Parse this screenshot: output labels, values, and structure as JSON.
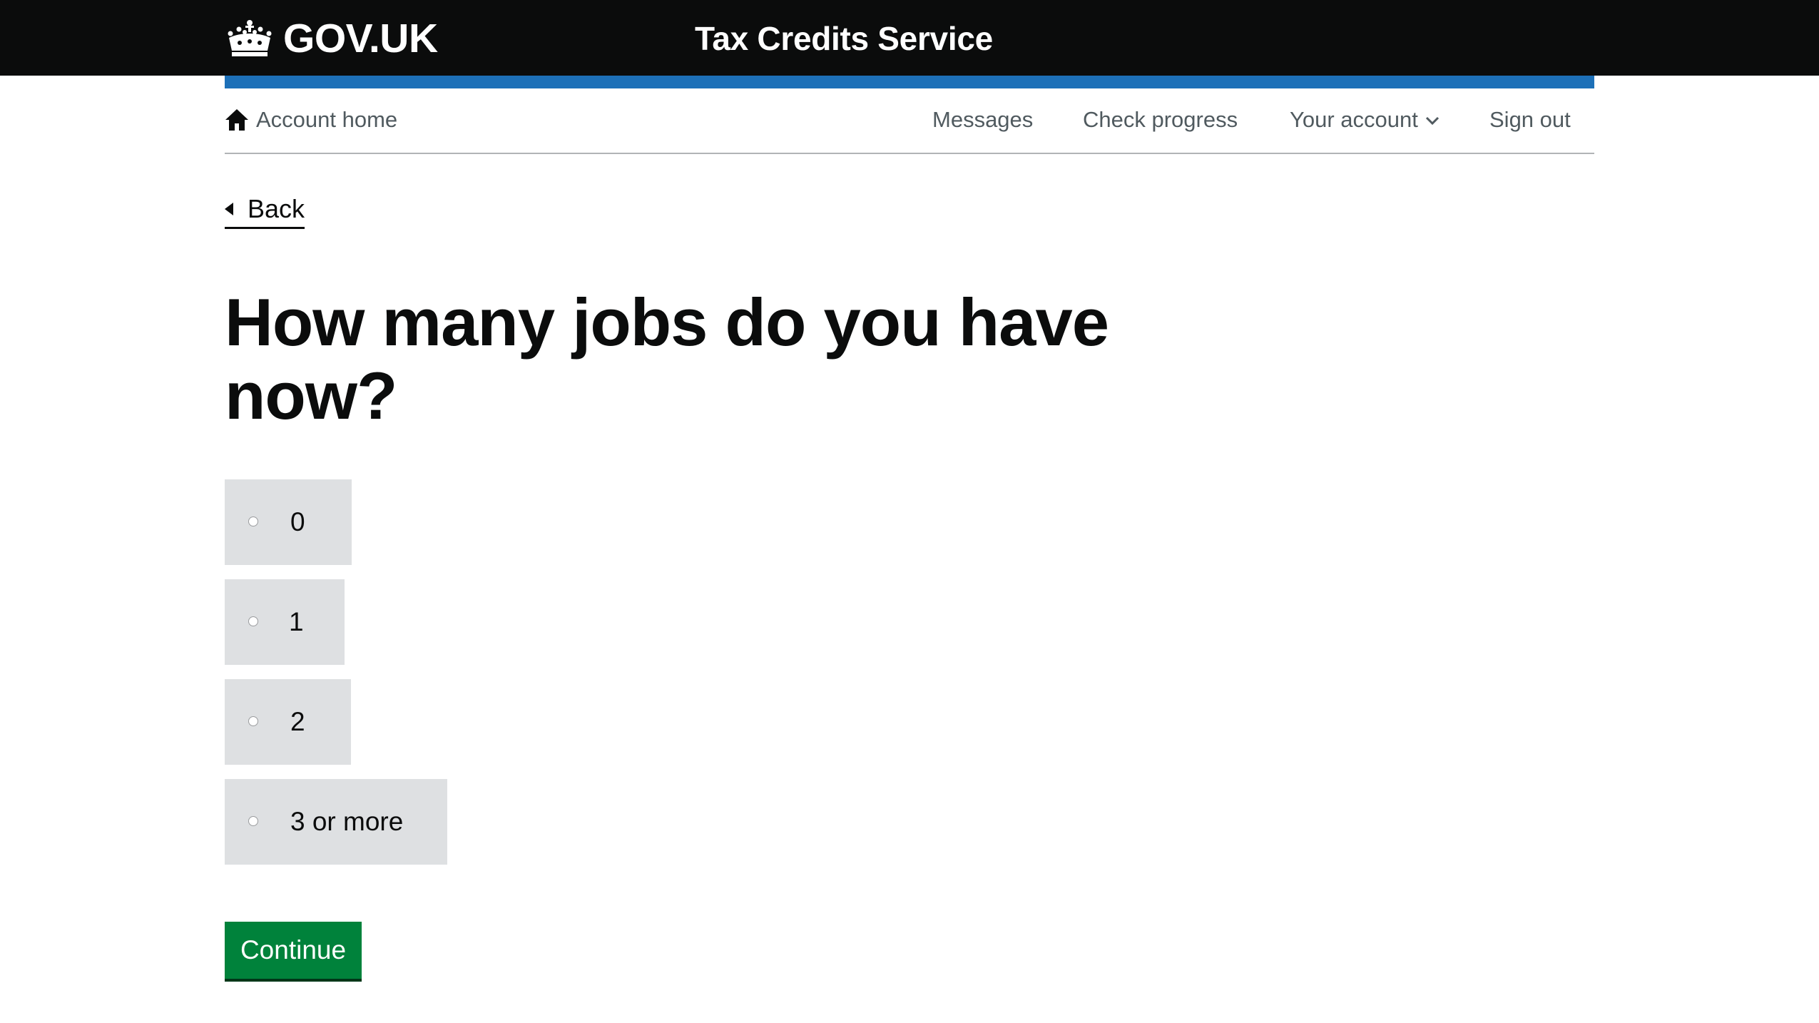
{
  "header": {
    "logo_text": "GOV.UK",
    "logo_icon": "crown-icon",
    "service_name": "Tax Credits Service",
    "colors": {
      "background": "#0b0c0c",
      "accent_bar": "#1d70b8"
    }
  },
  "account_nav": {
    "home_icon": "home-icon",
    "home_label": "Account home",
    "links": [
      {
        "label": "Messages"
      },
      {
        "label": "Check progress"
      },
      {
        "label": "Your account",
        "icon": "chevron-down-icon"
      },
      {
        "label": "Sign out"
      }
    ]
  },
  "main": {
    "back_label": "Back",
    "question": "How many jobs do you have now?",
    "options": [
      {
        "label": "0",
        "selected": false
      },
      {
        "label": "1",
        "selected": false
      },
      {
        "label": "2",
        "selected": false
      },
      {
        "label": "3 or more",
        "selected": false
      }
    ],
    "continue_label": "Continue",
    "colors": {
      "option_background": "#dee0e2",
      "button": "#00823b"
    }
  }
}
